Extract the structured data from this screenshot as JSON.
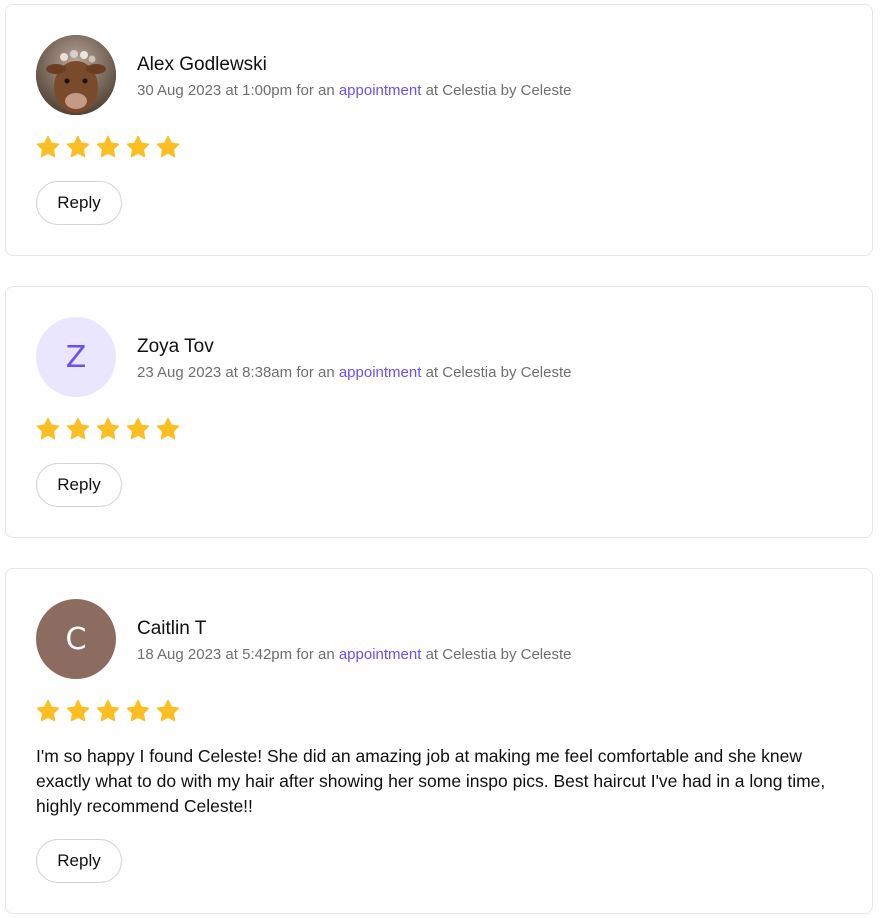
{
  "reviews": [
    {
      "author": "Alex Godlewski",
      "date": "30 Aug 2023 at 1:00pm",
      "meta_prefix": "for an",
      "meta_link": "appointment",
      "meta_suffix": "at Celestia by Celeste",
      "rating": 5,
      "avatar_type": "photo",
      "avatar_letter": "",
      "text": "",
      "reply_label": "Reply"
    },
    {
      "author": "Zoya Tov",
      "date": "23 Aug 2023 at 8:38am",
      "meta_prefix": "for an",
      "meta_link": "appointment",
      "meta_suffix": "at Celestia by Celeste",
      "rating": 5,
      "avatar_type": "letter",
      "avatar_letter": "Z",
      "avatar_bg": "#e9e6fe",
      "avatar_fg": "#6950f3",
      "text": "",
      "reply_label": "Reply"
    },
    {
      "author": "Caitlin T",
      "date": "18 Aug 2023 at 5:42pm",
      "meta_prefix": "for an",
      "meta_link": "appointment",
      "meta_suffix": "at Celestia by Celeste",
      "rating": 5,
      "avatar_type": "letter",
      "avatar_letter": "C",
      "avatar_bg": "#8c6b60",
      "avatar_fg": "#ffffff",
      "text": "I'm so happy I found Celeste! She did an amazing job at making me feel comfortable and she knew exactly what to do with my hair after showing her some inspo pics. Best haircut I've had in a long time, highly recommend Celeste!!",
      "reply_label": "Reply"
    }
  ],
  "colors": {
    "star": "#fbbf24",
    "link": "#6950f3",
    "meta": "#6f6f6f",
    "border": "#e6e6e6"
  },
  "icons": {
    "star": "star-icon"
  }
}
